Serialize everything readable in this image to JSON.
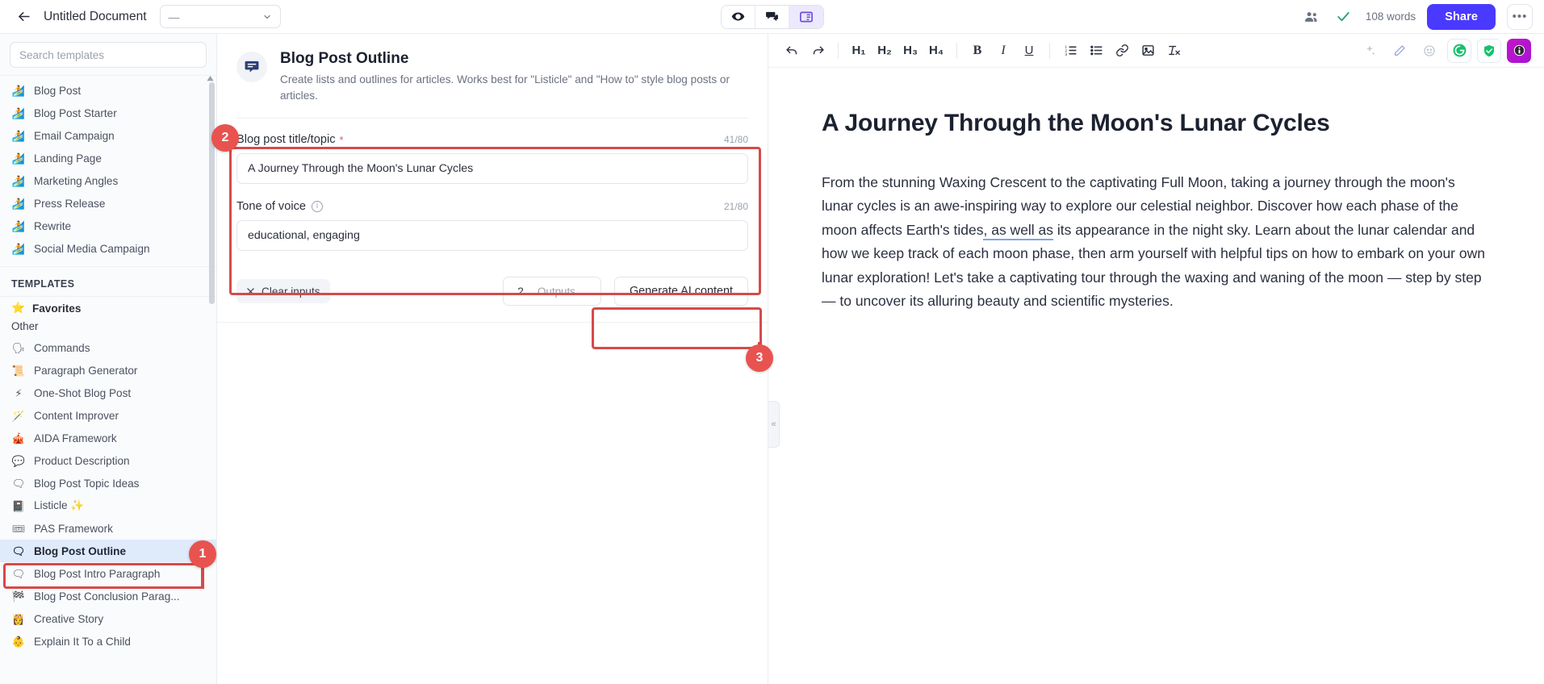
{
  "topbar": {
    "back_icon": "arrow-left-icon",
    "doc_title": "Untitled Document",
    "folder_value": "—",
    "view_buttons": [
      {
        "name": "preview-view",
        "icon": "eye-icon",
        "active": false
      },
      {
        "name": "comments-view",
        "icon": "comment-icon",
        "active": false
      },
      {
        "name": "split-view",
        "icon": "panel-layout-icon",
        "active": true
      }
    ],
    "collaborators_icon": "people-icon",
    "saved_icon": "check-icon",
    "word_count": "108 words",
    "share_label": "Share",
    "more_label": "•••"
  },
  "sidebar": {
    "search_placeholder": "Search templates",
    "search_value": "",
    "top_items": [
      {
        "emoji": "🏄",
        "label": "Blog Post"
      },
      {
        "emoji": "🏄",
        "label": "Blog Post Starter"
      },
      {
        "emoji": "🏄",
        "label": "Email Campaign"
      },
      {
        "emoji": "🏄",
        "label": "Landing Page"
      },
      {
        "emoji": "🏄",
        "label": "Marketing Angles"
      },
      {
        "emoji": "🏄",
        "label": "Press Release"
      },
      {
        "emoji": "🏄",
        "label": "Rewrite"
      },
      {
        "emoji": "🏄",
        "label": "Social Media Campaign"
      }
    ],
    "section_title": "TEMPLATES",
    "favorites_label": "Favorites",
    "favorites_emoji": "⭐",
    "other_label": "Other",
    "other_items": [
      {
        "emoji": "🗣",
        "label": "Commands",
        "selected": false
      },
      {
        "emoji": "📜",
        "label": "Paragraph Generator",
        "selected": false
      },
      {
        "emoji": "⚡",
        "label": "One-Shot Blog Post",
        "selected": false
      },
      {
        "emoji": "🪄",
        "label": "Content Improver",
        "selected": false
      },
      {
        "emoji": "🎪",
        "label": "AIDA Framework",
        "selected": false
      },
      {
        "emoji": "💬",
        "label": "Product Description",
        "selected": false
      },
      {
        "emoji": "🗨",
        "label": "Blog Post Topic Ideas",
        "selected": false
      },
      {
        "emoji": "📓",
        "label": "Listicle ✨",
        "selected": false
      },
      {
        "emoji": "🎟",
        "label": "PAS Framework",
        "selected": false
      },
      {
        "emoji": "🗨",
        "label": "Blog Post Outline",
        "selected": true
      },
      {
        "emoji": "🗨",
        "label": "Blog Post Intro Paragraph",
        "selected": false
      },
      {
        "emoji": "🏁",
        "label": "Blog Post Conclusion Parag...",
        "selected": false
      },
      {
        "emoji": "👸",
        "label": "Creative Story",
        "selected": false
      },
      {
        "emoji": "👶",
        "label": "Explain It To a Child",
        "selected": false
      }
    ]
  },
  "form": {
    "icon": "speech-bubble-icon",
    "title": "Blog Post Outline",
    "description": "Create lists and outlines for articles. Works best for \"Listicle\" and \"How to\" style blog posts or articles.",
    "fields": [
      {
        "label": "Blog post title/topic",
        "required": "*",
        "counter": "41/80",
        "value": "A Journey Through the Moon's Lunar Cycles",
        "placeholder": "",
        "has_info": false
      },
      {
        "label": "Tone of voice",
        "required": "",
        "counter": "21/80",
        "value": "educational, engaging",
        "placeholder": "",
        "has_info": true
      }
    ],
    "clear_label": "Clear inputs",
    "clear_icon": "close-icon",
    "outputs_value": "2",
    "outputs_label": "Outputs",
    "generate_label": "Generate AI content"
  },
  "editor": {
    "toolbar": {
      "undo": "undo-icon",
      "redo": "redo-icon",
      "headings": [
        "H₁",
        "H₂",
        "H₃",
        "H₄"
      ],
      "bold": "B",
      "italic": "I",
      "underline": "U",
      "ordered_list": "ordered-list-icon",
      "bullet_list": "bullet-list-icon",
      "link": "link-icon",
      "image": "image-icon",
      "clear_format": "clear-format-icon",
      "right_icons": [
        "sparkles-icon",
        "pen-icon",
        "emoji-icon",
        "grammarly-icon",
        "shield-check-icon",
        "info-badge-icon"
      ]
    },
    "title": "A Journey Through the Moon's Lunar Cycles",
    "paragraph_part1": "From the stunning Waxing Crescent to the captivating Full Moon, taking a journey through the moon's lunar cycles is an awe-inspiring way to explore our celestial neighbor. Discover how each phase of the moon affects Earth's tides",
    "paragraph_highlight": ", as well as",
    "paragraph_part2": " its appearance in the night sky. Learn about the lunar calendar and how we keep track of each moon phase, then arm yourself with helpful tips on how to embark on your own lunar exploration! Let's take a captivating tour through the waxing and waning of the moon — step by step — to uncover its alluring beauty and scientific mysteries."
  },
  "collapse_handle": {
    "icon": "chevron-double-left-icon",
    "label": "«"
  },
  "annotations": [
    {
      "number": "1",
      "target": "sidebar-item-blog-post-outline"
    },
    {
      "number": "2",
      "target": "template-input-fields"
    },
    {
      "number": "3",
      "target": "generate-ai-content-button"
    }
  ],
  "colors": {
    "accent_blue": "#4a3aff",
    "annotation_red": "#e8534f",
    "selected_row": "#dfeafb",
    "grammarly_green": "#11a683",
    "magenta_badge": "#c215c6"
  }
}
